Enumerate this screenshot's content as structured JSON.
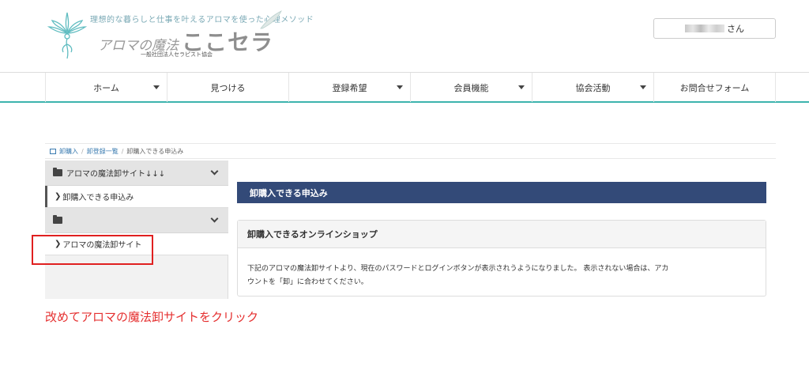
{
  "header": {
    "tagline": "理想的な暮らしと仕事を叶えるアロマを使った心理メソッド",
    "logo_sub": "アロマの魔法",
    "logo_title": "ここセラ",
    "logo_org": "一般社団法人セラピスト協会",
    "user_suffix": "さん"
  },
  "nav": {
    "items": [
      {
        "label": "ホーム",
        "dropdown": true
      },
      {
        "label": "見つける",
        "dropdown": false
      },
      {
        "label": "登録希望",
        "dropdown": true
      },
      {
        "label": "会員機能",
        "dropdown": true
      },
      {
        "label": "協会活動",
        "dropdown": true
      },
      {
        "label": "お問合せフォーム",
        "dropdown": false
      }
    ]
  },
  "breadcrumb": {
    "items": [
      "卸購入",
      "卸登録一覧",
      "卸購入できる申込み"
    ],
    "separator": "/"
  },
  "sidebar": {
    "group1_label": "アロマの魔法卸サイト↓↓↓",
    "group1_item": "卸購入できる申込み",
    "group2_label": "",
    "group2_item": "アロマの魔法卸サイト"
  },
  "main": {
    "title": "卸購入できる申込み",
    "panel_title": "卸購入できるオンラインショップ",
    "panel_text_line1": "下記のアロマの魔法卸サイトより、現在のパスワードとログインボタンが表示されうようになりました。 表示されない場合は、アカ",
    "panel_text_line2": "ウントを「卸」に合わせてください。"
  },
  "annotation": "改めてアロマの魔法卸サイトをクリック",
  "colors": {
    "accent_teal": "#3db3ad",
    "title_bar": "#334a78",
    "highlight_red": "#e02020"
  }
}
